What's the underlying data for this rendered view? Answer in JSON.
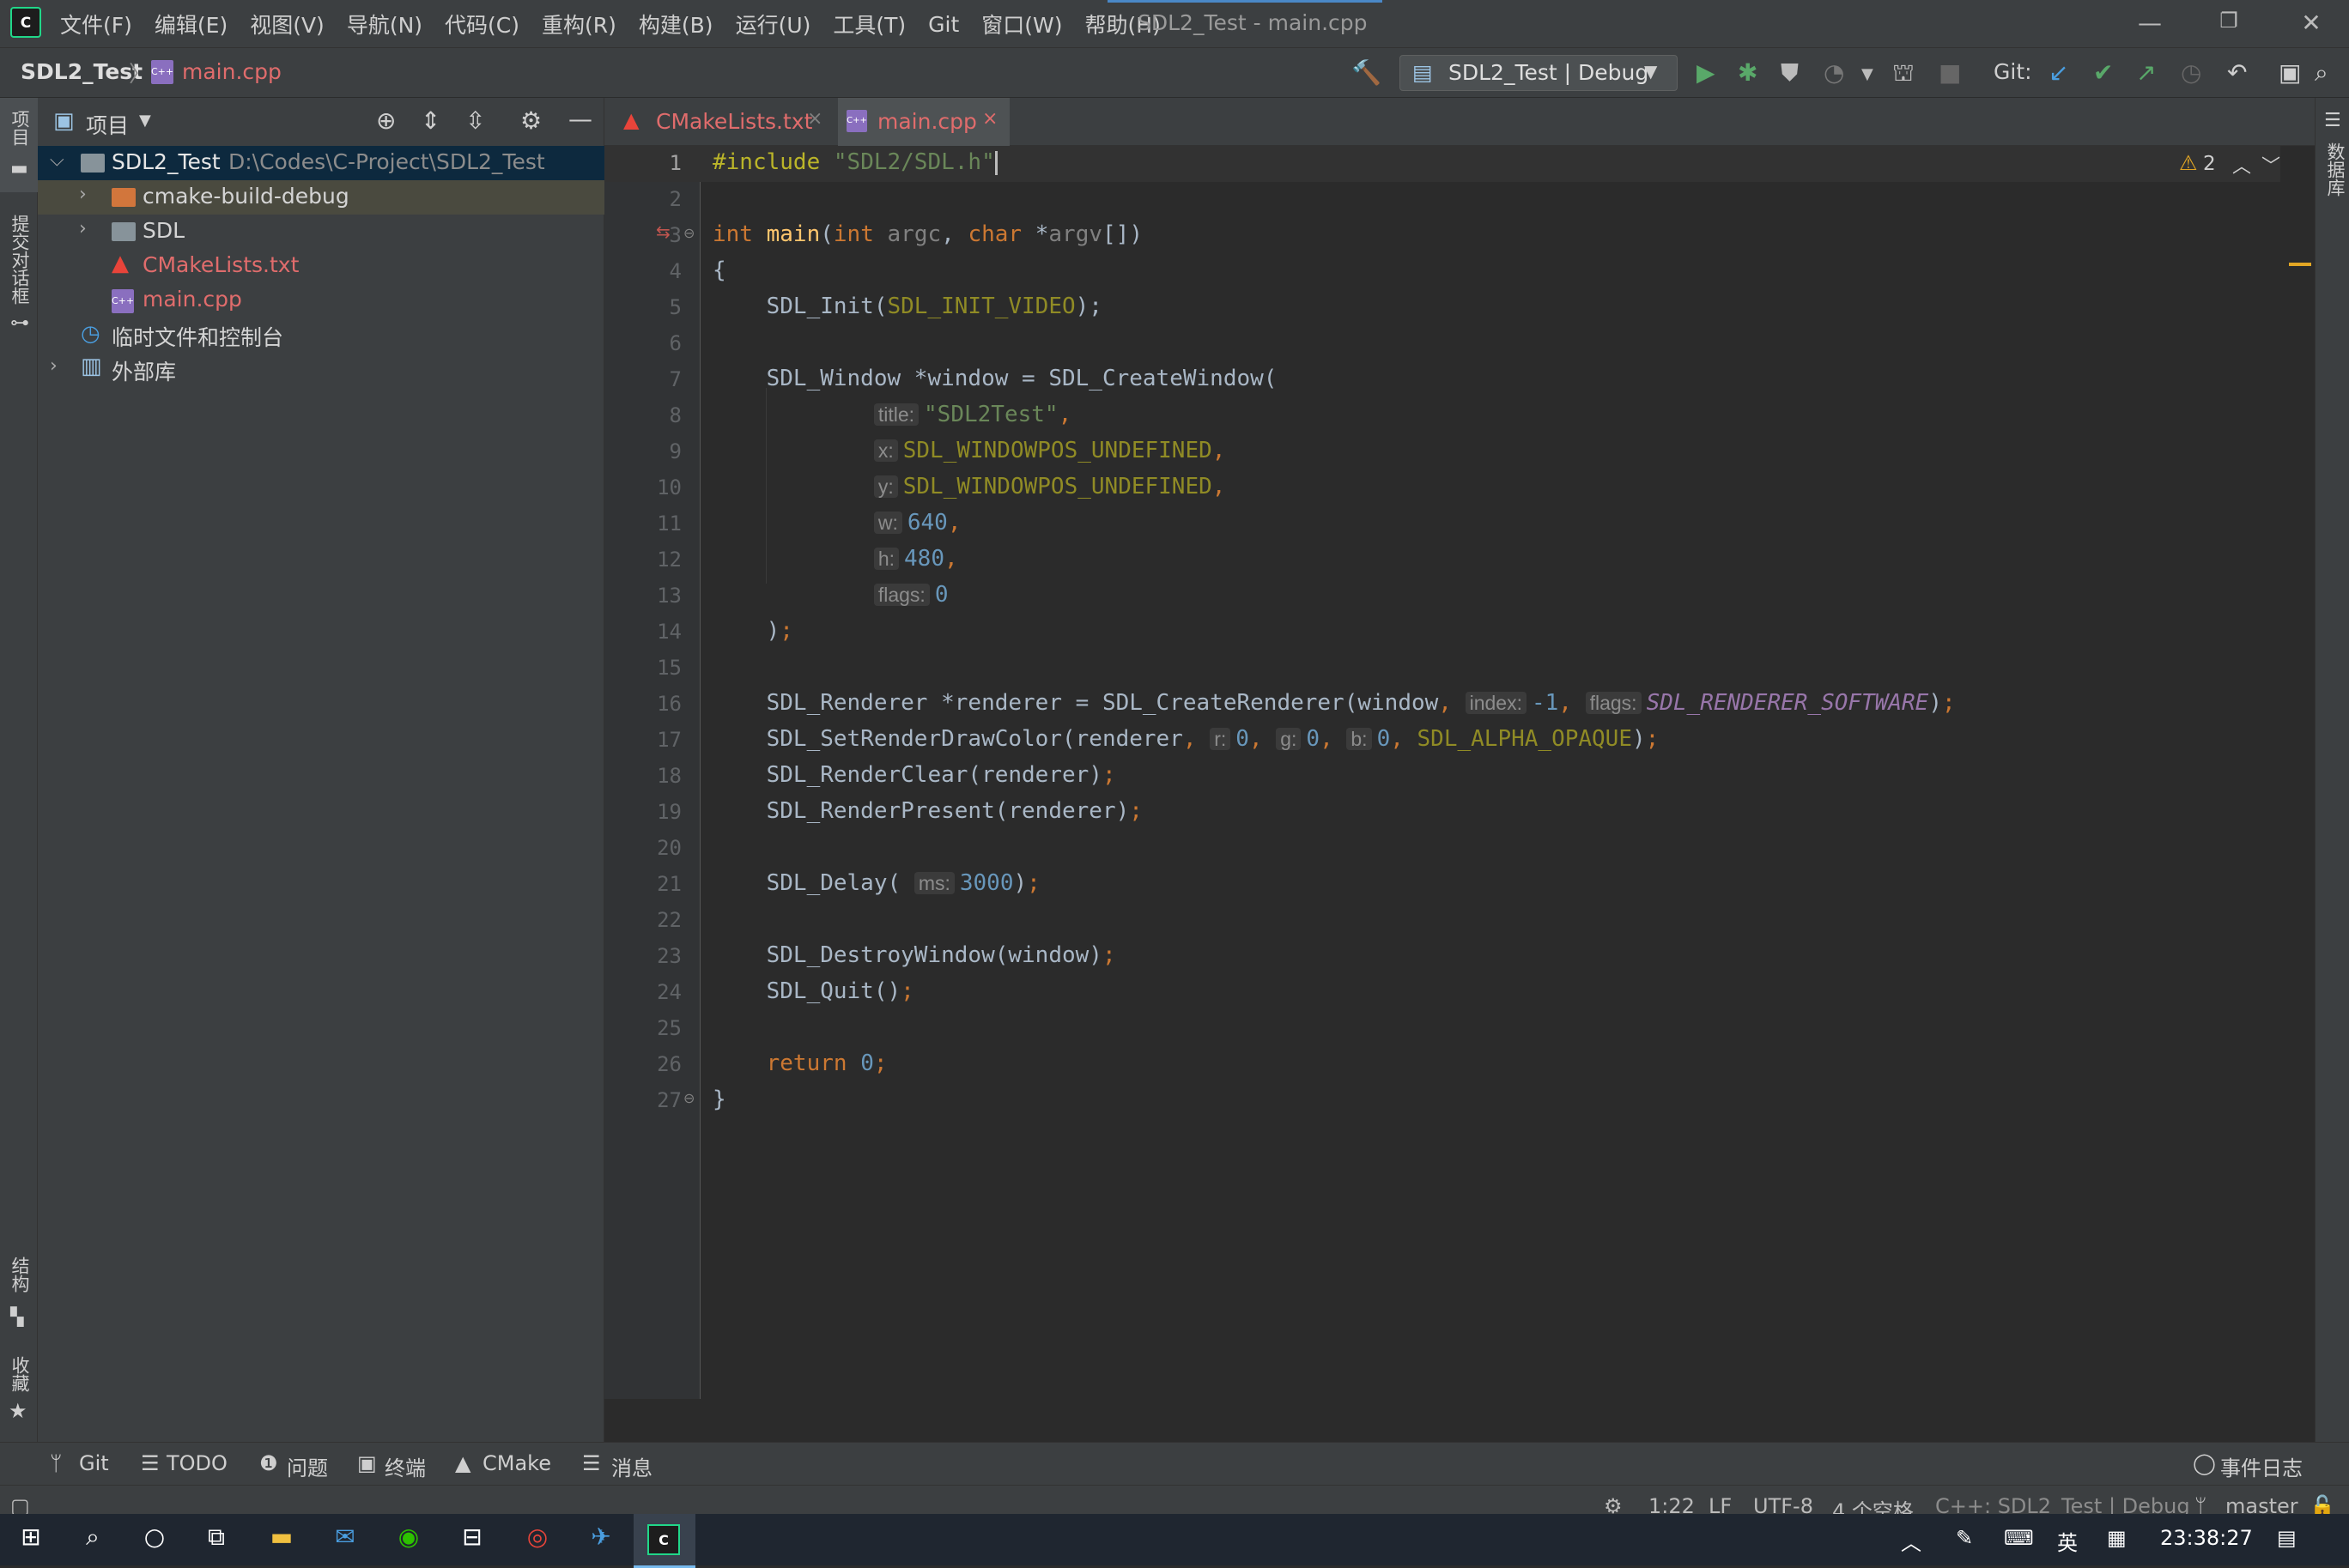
{
  "menu": [
    "文件(F)",
    "编辑(E)",
    "视图(V)",
    "导航(N)",
    "代码(C)",
    "重构(R)",
    "构建(B)",
    "运行(U)",
    "工具(T)",
    "Git",
    "窗口(W)",
    "帮助(H)"
  ],
  "window_title": "SDL2_Test - main.cpp",
  "breadcrumb": {
    "project": "SDL2_Test",
    "file": "main.cpp"
  },
  "run_config": "SDL2_Test | Debug",
  "git_label": "Git:",
  "left_strip": {
    "project": "项目",
    "commit": "提交对话框",
    "structure": "结构",
    "bookmarks": "收藏"
  },
  "right_strip": {
    "database": "数据库"
  },
  "project_panel": {
    "title": "项目",
    "tree": [
      {
        "label": "SDL2_Test",
        "path": "D:\\Codes\\C-Project\\SDL2_Test"
      },
      {
        "label": "cmake-build-debug"
      },
      {
        "label": "SDL"
      },
      {
        "label": "CMakeLists.txt"
      },
      {
        "label": "main.cpp"
      },
      {
        "label": "临时文件和控制台"
      },
      {
        "label": "外部库"
      }
    ]
  },
  "tabs": [
    {
      "label": "CMakeLists.txt",
      "active": false
    },
    {
      "label": "main.cpp",
      "active": true
    }
  ],
  "inspection": {
    "warnings": "2"
  },
  "editor": {
    "line_numbers": [
      "1",
      "2",
      "3",
      "4",
      "5",
      "6",
      "7",
      "8",
      "9",
      "10",
      "11",
      "12",
      "13",
      "14",
      "15",
      "16",
      "17",
      "18",
      "19",
      "20",
      "21",
      "22",
      "23",
      "24",
      "25",
      "26",
      "27"
    ],
    "hints": {
      "title": "title:",
      "x": "x:",
      "y": "y:",
      "w": "w:",
      "h": "h:",
      "flags": "flags:",
      "index": "index:",
      "r": "r:",
      "g": "g:",
      "b": "b:",
      "ms": "ms:"
    }
  },
  "bottom_tabs": [
    "Git",
    "TODO",
    "问题",
    "终端",
    "CMake",
    "消息",
    "事件日志"
  ],
  "status": {
    "position": "1:22",
    "line_sep": "LF",
    "encoding": "UTF-8",
    "indent": "4 个空格",
    "context": "C++: SDL2_Test | Debug",
    "branch": "master"
  },
  "taskbar": {
    "ime": "英",
    "time": "23:38:27"
  },
  "colors": {
    "keyword": "#cc7832",
    "string": "#6a8759",
    "number": "#6897bb",
    "macro": "#908b25",
    "accent": "#21d789"
  }
}
